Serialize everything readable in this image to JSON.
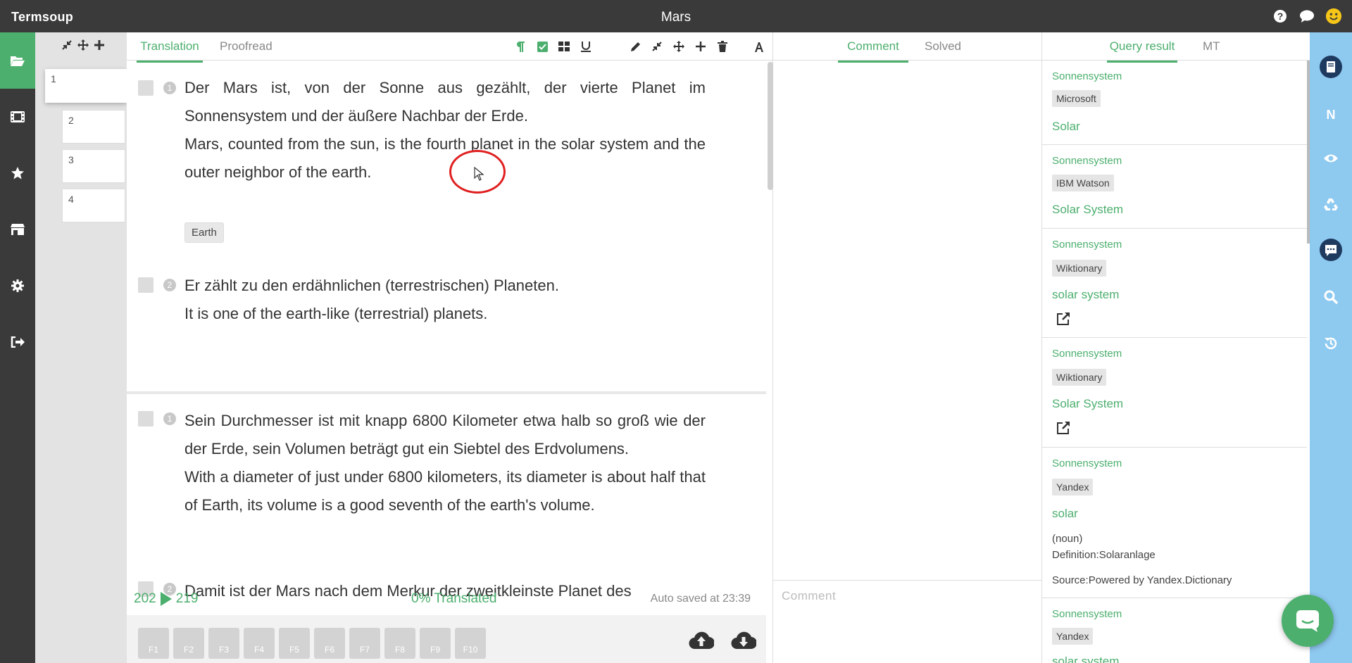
{
  "app": {
    "name": "Termsoup",
    "document_title": "Mars"
  },
  "colors": {
    "accent": "#4caf6e",
    "topbar": "#3a3a3a",
    "right_rail": "#8ec9f0",
    "cursor_highlight": "#e02020"
  },
  "top_icons": [
    "help-icon",
    "chat-icon",
    "smiley-avatar-icon"
  ],
  "left_rail": [
    "folder-open-icon",
    "film-icon",
    "star-icon",
    "store-icon",
    "gear-icon",
    "sign-out-icon"
  ],
  "pages": {
    "tools": [
      "compress-icon",
      "move-icon",
      "plus-icon"
    ],
    "items": [
      "1",
      "2",
      "3",
      "4"
    ],
    "active": "1"
  },
  "translation": {
    "tabs": [
      "Translation",
      "Proofread"
    ],
    "active_tab": "Translation",
    "tools": [
      "paragraph-icon",
      "check-square-icon",
      "grid-icon",
      "underline-icon",
      "pencil-icon",
      "compress-icon",
      "move-icon",
      "plus-icon",
      "trash-icon",
      "font-icon"
    ],
    "segments": [
      {
        "num": "1",
        "source": "Der Mars ist, von der Sonne aus gezählt, der vierte Planet im Sonnensystem und der äußere Nachbar der Erde.",
        "target": "Mars, counted from the sun, is the fourth planet in the solar system and the outer neighbor of the earth.",
        "term": "Earth"
      },
      {
        "num": "2",
        "source": "Er zählt zu den erdähnlichen (terrestrischen) Planeten.",
        "target": "It is one of the earth-like (terrestrial) planets."
      },
      {
        "num": "1",
        "source": "Sein Durchmesser ist mit knapp 6800 Kilometer etwa halb so groß wie der der Erde, sein Volumen beträgt gut ein Siebtel des Erdvolumens.",
        "target": "With a diameter of just under 6800 kilometers, its diameter is about half that of Earth, its volume is a good seventh of the earth's volume."
      },
      {
        "num": "2",
        "source": "Damit ist der Mars nach dem Merkur der zweitkleinste Planet des"
      }
    ],
    "status": {
      "current": "202",
      "total": "219",
      "progress_text": "0% Translated",
      "autosave": "Auto saved at 23:39"
    },
    "fkeys": [
      "F1",
      "F2",
      "F3",
      "F4",
      "F5",
      "F6",
      "F7",
      "F8",
      "F9",
      "F10"
    ]
  },
  "comments": {
    "tabs": [
      "Comment",
      "Solved"
    ],
    "active_tab": "Comment",
    "input_placeholder": "Comment"
  },
  "query": {
    "tabs": [
      "Query result",
      "MT"
    ],
    "active_tab": "Query result",
    "results": [
      {
        "source": "Sonnensystem",
        "provider": "Microsoft",
        "target": "Solar"
      },
      {
        "source": "Sonnensystem",
        "provider": "IBM Watson",
        "target": "Solar System"
      },
      {
        "source": "Sonnensystem",
        "provider": "Wiktionary",
        "target": "solar system"
      },
      {
        "source": "Sonnensystem",
        "provider": "Wiktionary",
        "target": "Solar System"
      },
      {
        "source": "Sonnensystem",
        "provider": "Yandex",
        "target": "solar",
        "pos": "(noun)",
        "definition": "Definition:Solaranlage",
        "src_note": "Source:Powered by Yandex.Dictionary"
      },
      {
        "source": "Sonnensystem",
        "provider": "Yandex",
        "target": "solar system"
      }
    ]
  },
  "right_rail": [
    "book-icon",
    "n-icon",
    "eye-icon",
    "recycle-icon",
    "comment-icon",
    "search-icon",
    "history-icon"
  ]
}
